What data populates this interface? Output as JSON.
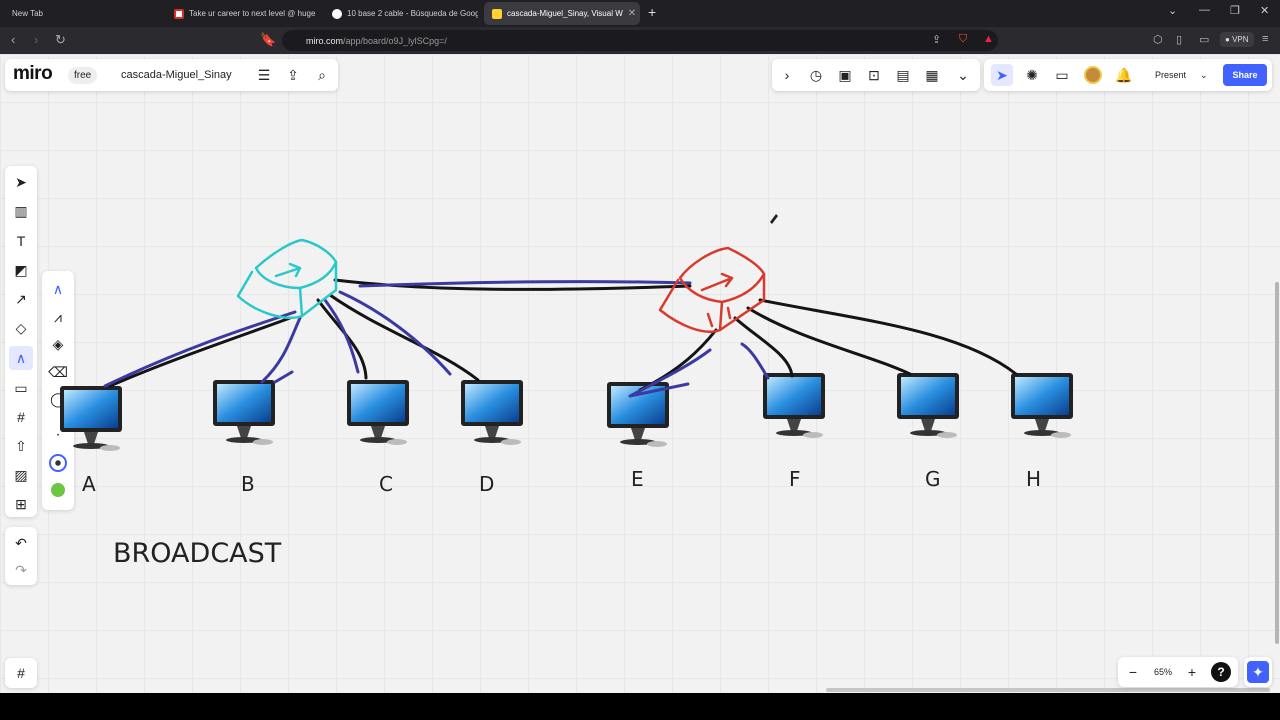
{
  "browser": {
    "tabs": [
      {
        "title": "New Tab"
      },
      {
        "title": "Take ur career to next level @ huge"
      },
      {
        "title": "10 base 2 cable - Búsqueda de Goog"
      },
      {
        "title": "cascada-Miguel_Sinay, Visual W"
      }
    ],
    "url_host": "miro.com",
    "url_path": "/app/board/o9J_lylSCpg=/",
    "vpn_label": "VPN"
  },
  "miro": {
    "logo": "miro",
    "plan_badge": "free",
    "board_name": "cascada-Miguel_Sinay",
    "present_label": "Present",
    "share_label": "Share",
    "zoom": "65%",
    "help": "?"
  },
  "canvas": {
    "labels": [
      "A",
      "B",
      "C",
      "D",
      "E",
      "F",
      "G",
      "H"
    ],
    "caption": "BROADCAST"
  },
  "colors": {
    "accent": "#4262ff",
    "switch_left": "#2bc7c9",
    "switch_right": "#d83a2e",
    "cable_black": "#141414",
    "cable_blue": "#3a3aa0"
  }
}
